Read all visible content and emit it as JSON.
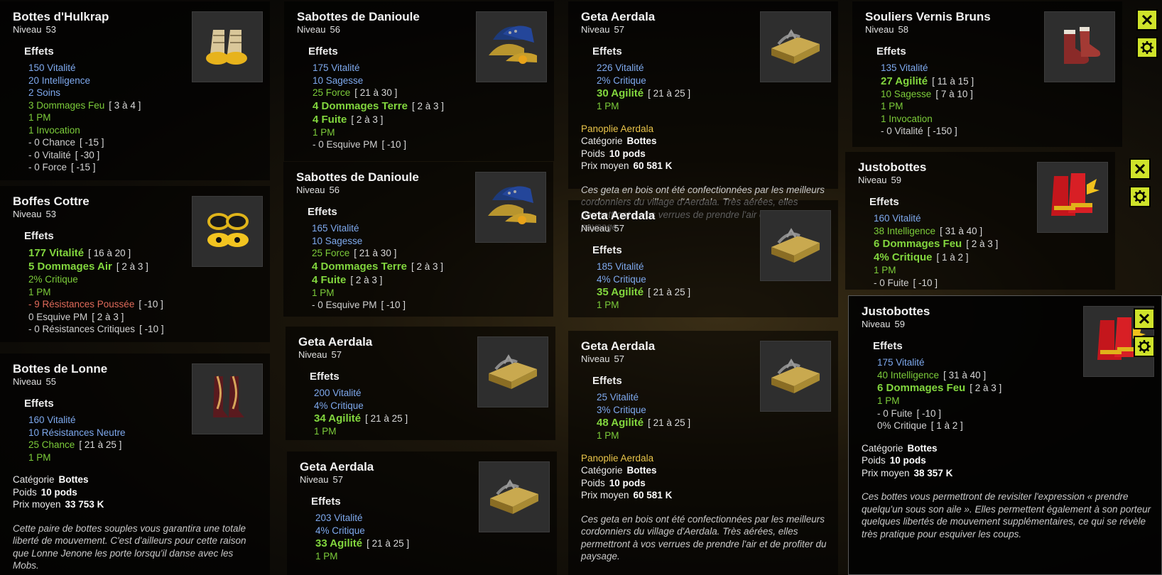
{
  "colors": {
    "accent": "#cfe32a",
    "set_name": "#e9c44a",
    "stat_blue": "#7ea9ee",
    "stat_green": "#7ccc3a",
    "stat_red": "#e06a5a"
  },
  "labels": {
    "effects": "Effets",
    "category": "Catégorie",
    "weight": "Poids",
    "avg_price": "Prix moyen",
    "level": "Niveau"
  },
  "cards": [
    {
      "name": "Bottes d'Hulkrap",
      "level": "53",
      "icon": "hulkrap-boots-icon",
      "effects": [
        {
          "text": "150 Vitalité",
          "color": "c-blue"
        },
        {
          "text": "20 Intelligence",
          "color": "c-blue"
        },
        {
          "text": "2 Soins",
          "color": "c-blue"
        },
        {
          "text": "3 Dommages Feu",
          "range": "[ 3 à 4 ]",
          "color": "c-green"
        },
        {
          "text": "1 PM",
          "color": "c-green"
        },
        {
          "text": "1 Invocation",
          "color": "c-green"
        },
        {
          "text": "- 0 Chance",
          "range": "[ -15 ]",
          "color": "c-grey"
        },
        {
          "text": "- 0 Vitalité",
          "range": "[ -30 ]",
          "color": "c-grey"
        },
        {
          "text": "- 0 Force",
          "range": "[ -15 ]",
          "color": "c-grey"
        }
      ]
    },
    {
      "name": "Boffes Cottre",
      "level": "53",
      "icon": "cottre-boots-icon",
      "effects": [
        {
          "text": "177 Vitalité",
          "range": "[ 16 à 20 ]",
          "color": "c-bgreen",
          "big": true
        },
        {
          "text": "5 Dommages Air",
          "range": "[ 2 à 3 ]",
          "color": "c-bgreen",
          "big": true
        },
        {
          "text": "2% Critique",
          "color": "c-green"
        },
        {
          "text": "1 PM",
          "color": "c-green"
        },
        {
          "text": "- 9 Résistances Poussée",
          "range": "[ -10 ]",
          "color": "c-red"
        },
        {
          "text": "0 Esquive PM",
          "range": "[ 2 à 3 ]",
          "color": "c-grey"
        },
        {
          "text": "- 0 Résistances Critiques",
          "range": "[ -10 ]",
          "color": "c-grey"
        }
      ]
    },
    {
      "name": "Bottes de Lonne",
      "level": "55",
      "icon": "lonne-boots-icon",
      "effects": [
        {
          "text": "160 Vitalité",
          "color": "c-blue"
        },
        {
          "text": "10 Résistances Neutre",
          "color": "c-blue"
        },
        {
          "text": "25 Chance",
          "range": "[ 21 à 25 ]",
          "color": "c-green"
        },
        {
          "text": "1 PM",
          "color": "c-green"
        }
      ],
      "category": "Bottes",
      "weight": "10 pods",
      "price": "33 753 K",
      "description": "Cette paire de bottes souples vous garantira une totale liberté de mouvement. C'est d'ailleurs pour cette raison que Lonne Jenone les porte lorsqu'il danse avec les Mobs."
    },
    {
      "name": "Sabottes de Danioule",
      "level": "56",
      "icon": "danioule-sabots-icon",
      "effects": [
        {
          "text": "175 Vitalité",
          "color": "c-blue"
        },
        {
          "text": "10 Sagesse",
          "color": "c-blue"
        },
        {
          "text": "25 Force",
          "range": "[ 21 à 30 ]",
          "color": "c-green"
        },
        {
          "text": "4 Dommages Terre",
          "range": "[ 2 à 3 ]",
          "color": "c-bgreen",
          "big": true
        },
        {
          "text": "4 Fuite",
          "range": "[ 2 à 3 ]",
          "color": "c-bgreen",
          "big": true
        },
        {
          "text": "1 PM",
          "color": "c-green"
        },
        {
          "text": "- 0 Esquive PM",
          "range": "[ -10 ]",
          "color": "c-grey"
        }
      ]
    },
    {
      "name": "Sabottes de Danioule",
      "level": "56",
      "icon": "danioule-sabots-icon",
      "effects": [
        {
          "text": "165 Vitalité",
          "color": "c-blue"
        },
        {
          "text": "10 Sagesse",
          "color": "c-blue"
        },
        {
          "text": "25 Force",
          "range": "[ 21 à 30 ]",
          "color": "c-green"
        },
        {
          "text": "4 Dommages Terre",
          "range": "[ 2 à 3 ]",
          "color": "c-bgreen",
          "big": true
        },
        {
          "text": "4 Fuite",
          "range": "[ 2 à 3 ]",
          "color": "c-bgreen",
          "big": true
        },
        {
          "text": "1 PM",
          "color": "c-green"
        },
        {
          "text": "- 0 Esquive PM",
          "range": "[ -10 ]",
          "color": "c-grey"
        }
      ]
    },
    {
      "name": "Geta Aerdala",
      "level": "57",
      "icon": "geta-icon",
      "effects": [
        {
          "text": "200 Vitalité",
          "color": "c-blue"
        },
        {
          "text": "4% Critique",
          "color": "c-blue"
        },
        {
          "text": "34 Agilité",
          "range": "[ 21 à 25 ]",
          "color": "c-bgreen",
          "big": true
        },
        {
          "text": "1 PM",
          "color": "c-green"
        }
      ]
    },
    {
      "name": "Geta Aerdala",
      "level": "57",
      "icon": "geta-icon",
      "effects": [
        {
          "text": "203 Vitalité",
          "color": "c-blue"
        },
        {
          "text": "4% Critique",
          "color": "c-blue"
        },
        {
          "text": "33 Agilité",
          "range": "[ 21 à 25 ]",
          "color": "c-bgreen",
          "big": true
        },
        {
          "text": "1 PM",
          "color": "c-green"
        }
      ]
    },
    {
      "name": "Geta Aerdala",
      "level": "57",
      "icon": "geta-icon",
      "effects": [
        {
          "text": "226 Vitalité",
          "color": "c-blue"
        },
        {
          "text": "2% Critique",
          "color": "c-blue"
        },
        {
          "text": "30 Agilité",
          "range": "[ 21 à 25 ]",
          "color": "c-bgreen",
          "big": true
        },
        {
          "text": "1 PM",
          "color": "c-green"
        }
      ],
      "set": "Panoplie Aerdala",
      "category": "Bottes",
      "weight": "10 pods",
      "price": "60 581 K",
      "description": "Ces geta en bois ont été confectionnées par les meilleurs cordonniers du village d'Aerdala. Très aérées, elles permettront à vos verrues de prendre l'air et de profiter du paysage."
    },
    {
      "name": "Geta Aerdala",
      "level": "57",
      "icon": "geta-icon",
      "effects": [
        {
          "text": "185 Vitalité",
          "color": "c-blue"
        },
        {
          "text": "4% Critique",
          "color": "c-blue"
        },
        {
          "text": "35 Agilité",
          "range": "[ 21 à 25 ]",
          "color": "c-bgreen",
          "big": true
        },
        {
          "text": "1 PM",
          "color": "c-green"
        }
      ]
    },
    {
      "name": "Geta Aerdala",
      "level": "57",
      "icon": "geta-icon",
      "effects": [
        {
          "text": "25 Vitalité",
          "color": "c-blue"
        },
        {
          "text": "3% Critique",
          "color": "c-blue"
        },
        {
          "text": "48 Agilité",
          "range": "[ 21 à 25 ]",
          "color": "c-bgreen",
          "big": true
        },
        {
          "text": "1 PM",
          "color": "c-green"
        }
      ],
      "set": "Panoplie Aerdala",
      "category": "Bottes",
      "weight": "10 pods",
      "price": "60 581 K",
      "description": "Ces geta en bois ont été confectionnées par les meilleurs cordonniers du village d'Aerdala. Très aérées, elles permettront à vos verrues de prendre l'air et de profiter du paysage."
    },
    {
      "name": "Souliers Vernis Bruns",
      "level": "58",
      "icon": "souliers-vernis-icon",
      "effects": [
        {
          "text": "135 Vitalité",
          "color": "c-blue"
        },
        {
          "text": "27 Agilité",
          "range": "[ 11 à 15 ]",
          "color": "c-bgreen",
          "big": true
        },
        {
          "text": "10 Sagesse",
          "range": "[ 7 à 10 ]",
          "color": "c-green"
        },
        {
          "text": "1 PM",
          "color": "c-green"
        },
        {
          "text": "1 Invocation",
          "color": "c-green"
        },
        {
          "text": "- 0 Vitalité",
          "range": "[ -150 ]",
          "color": "c-grey"
        }
      ]
    },
    {
      "name": "Justobottes",
      "level": "59",
      "icon": "justobottes-icon",
      "effects": [
        {
          "text": "160 Vitalité",
          "color": "c-blue"
        },
        {
          "text": "38 Intelligence",
          "range": "[ 31 à 40 ]",
          "color": "c-green"
        },
        {
          "text": "6 Dommages Feu",
          "range": "[ 2 à 3 ]",
          "color": "c-bgreen",
          "big": true
        },
        {
          "text": "4% Critique",
          "range": "[ 1 à 2 ]",
          "color": "c-bgreen",
          "big": true
        },
        {
          "text": "1 PM",
          "color": "c-green"
        },
        {
          "text": "- 0 Fuite",
          "range": "[ -10 ]",
          "color": "c-grey"
        }
      ]
    },
    {
      "name": "Justobottes",
      "level": "59",
      "icon": "justobottes-icon",
      "effects": [
        {
          "text": "175 Vitalité",
          "color": "c-blue"
        },
        {
          "text": "40 Intelligence",
          "range": "[ 31 à 40 ]",
          "color": "c-green"
        },
        {
          "text": "6 Dommages Feu",
          "range": "[ 2 à 3 ]",
          "color": "c-bgreen",
          "big": true
        },
        {
          "text": "1 PM",
          "color": "c-green"
        },
        {
          "text": "- 0 Fuite",
          "range": "[ -10 ]",
          "color": "c-grey"
        },
        {
          "text": "0% Critique",
          "range": "[ 1 à 2 ]",
          "color": "c-grey"
        }
      ],
      "category": "Bottes",
      "weight": "10 pods",
      "price": "38 357 K",
      "description": "Ces bottes vous permettront de revisiter l'expression « prendre quelqu'un sous son aile ». Elles permettent également à son porteur quelques libertés de mouvement supplémentaires, ce qui se révèle très pratique pour esquiver les coups."
    }
  ]
}
